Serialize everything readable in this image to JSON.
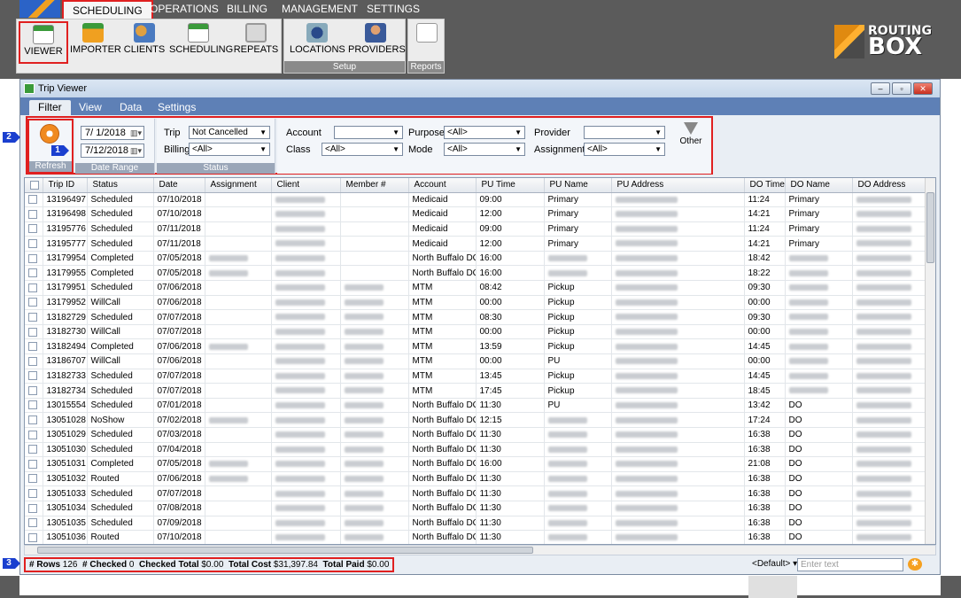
{
  "menu": [
    "SCHEDULING",
    "OPERATIONS",
    "BILLING",
    "MANAGEMENT",
    "SETTINGS"
  ],
  "ribbon": {
    "scheduling": [
      "VIEWER",
      "IMPORTER",
      "CLIENTS",
      "SCHEDULING",
      "REPEATS"
    ],
    "setup": [
      "LOCATIONS",
      "PROVIDERS"
    ],
    "setup_label": "Setup",
    "reports_label": "Reports"
  },
  "brand": {
    "line1": "ROUTING",
    "line2": "BOX"
  },
  "window": {
    "title": "Trip Viewer"
  },
  "tabs": [
    "Filter",
    "View",
    "Data",
    "Settings"
  ],
  "filter": {
    "refresh_label": "Refresh",
    "date_range_label": "Date Range",
    "date_from": "7/ 1/2018",
    "date_to": "7/12/2018",
    "status_label": "Status",
    "trip_label": "Trip",
    "trip_value": "Not Cancelled",
    "billing_label": "Billing",
    "billing_value": "<All>",
    "account_label": "Account",
    "account_value": "",
    "class_label": "Class",
    "class_value": "<All>",
    "purpose_label": "Purpose",
    "purpose_value": "<All>",
    "mode_label": "Mode",
    "mode_value": "<All>",
    "provider_label": "Provider",
    "provider_value": "",
    "assignment_label": "Assignment",
    "assignment_value": "<All>",
    "other_label": "Other"
  },
  "markers": [
    "1",
    "2",
    "3"
  ],
  "columns": [
    "Trip ID",
    "Status",
    "Date",
    "Assignment",
    "Client",
    "Member #",
    "Account",
    "PU Time",
    "PU Name",
    "PU Address",
    "DO Time",
    "DO Name",
    "DO Address"
  ],
  "rows": [
    [
      "13196497",
      "Scheduled",
      "07/10/2018",
      "Medicaid",
      "09:00",
      "Primary",
      "11:24",
      "Primary"
    ],
    [
      "13196498",
      "Scheduled",
      "07/10/2018",
      "Medicaid",
      "12:00",
      "Primary",
      "14:21",
      "Primary"
    ],
    [
      "13195776",
      "Scheduled",
      "07/11/2018",
      "Medicaid",
      "09:00",
      "Primary",
      "11:24",
      "Primary"
    ],
    [
      "13195777",
      "Scheduled",
      "07/11/2018",
      "Medicaid",
      "12:00",
      "Primary",
      "14:21",
      "Primary"
    ],
    [
      "13179954",
      "Completed",
      "07/05/2018",
      "North Buffalo DC",
      "16:00",
      "",
      "18:42",
      ""
    ],
    [
      "13179955",
      "Completed",
      "07/05/2018",
      "North Buffalo DC",
      "16:00",
      "",
      "18:22",
      ""
    ],
    [
      "13179951",
      "Scheduled",
      "07/06/2018",
      "MTM",
      "08:42",
      "Pickup",
      "09:30",
      ""
    ],
    [
      "13179952",
      "WillCall",
      "07/06/2018",
      "MTM",
      "00:00",
      "Pickup",
      "00:00",
      ""
    ],
    [
      "13182729",
      "Scheduled",
      "07/07/2018",
      "MTM",
      "08:30",
      "Pickup",
      "09:30",
      ""
    ],
    [
      "13182730",
      "WillCall",
      "07/07/2018",
      "MTM",
      "00:00",
      "Pickup",
      "00:00",
      ""
    ],
    [
      "13182494",
      "Completed",
      "07/06/2018",
      "MTM",
      "13:59",
      "Pickup",
      "14:45",
      ""
    ],
    [
      "13186707",
      "WillCall",
      "07/06/2018",
      "MTM",
      "00:00",
      "PU",
      "00:00",
      ""
    ],
    [
      "13182733",
      "Scheduled",
      "07/07/2018",
      "MTM",
      "13:45",
      "Pickup",
      "14:45",
      ""
    ],
    [
      "13182734",
      "Scheduled",
      "07/07/2018",
      "MTM",
      "17:45",
      "Pickup",
      "18:45",
      ""
    ],
    [
      "13015554",
      "Scheduled",
      "07/01/2018",
      "North Buffalo DC",
      "11:30",
      "PU",
      "13:42",
      "DO"
    ],
    [
      "13051028",
      "NoShow",
      "07/02/2018",
      "North Buffalo DC",
      "12:15",
      "",
      "17:24",
      "DO"
    ],
    [
      "13051029",
      "Scheduled",
      "07/03/2018",
      "North Buffalo DC",
      "11:30",
      "",
      "16:38",
      "DO"
    ],
    [
      "13051030",
      "Scheduled",
      "07/04/2018",
      "North Buffalo DC",
      "11:30",
      "",
      "16:38",
      "DO"
    ],
    [
      "13051031",
      "Completed",
      "07/05/2018",
      "North Buffalo DC",
      "16:00",
      "",
      "21:08",
      "DO"
    ],
    [
      "13051032",
      "Routed",
      "07/06/2018",
      "North Buffalo DC",
      "11:30",
      "",
      "16:38",
      "DO"
    ],
    [
      "13051033",
      "Scheduled",
      "07/07/2018",
      "North Buffalo DC",
      "11:30",
      "",
      "16:38",
      "DO"
    ],
    [
      "13051034",
      "Scheduled",
      "07/08/2018",
      "North Buffalo DC",
      "11:30",
      "",
      "16:38",
      "DO"
    ],
    [
      "13051035",
      "Scheduled",
      "07/09/2018",
      "North Buffalo DC",
      "11:30",
      "",
      "16:38",
      "DO"
    ],
    [
      "13051036",
      "Routed",
      "07/10/2018",
      "North Buffalo DC",
      "11:30",
      "",
      "16:38",
      "DO"
    ]
  ],
  "status": {
    "rows_label": "# Rows",
    "rows_value": "126",
    "checked_label": "# Checked",
    "checked_value": "0",
    "checked_total_label": "Checked Total",
    "checked_total_value": "$0.00",
    "total_cost_label": "Total Cost",
    "total_cost_value": "$31,397.84",
    "total_paid_label": "Total Paid",
    "total_paid_value": "$0.00",
    "layout_value": "<Default>",
    "search_placeholder": "Enter text"
  }
}
